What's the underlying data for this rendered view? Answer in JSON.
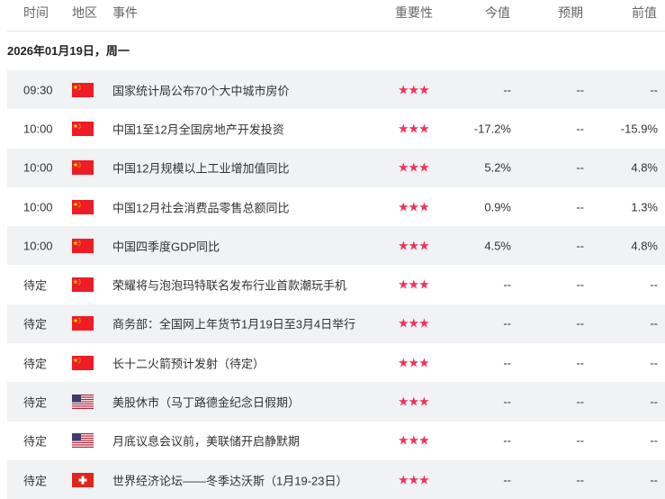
{
  "header": {
    "time": "时间",
    "region": "地区",
    "event": "事件",
    "importance": "重要性",
    "actual": "今值",
    "forecast": "预期",
    "previous": "前值"
  },
  "date": "2026年01月19日，周一",
  "rows": [
    {
      "time": "09:30",
      "flag": "cn",
      "event": "国家统计局公布70个大中城市房价",
      "stars": "★★★",
      "actual": "--",
      "forecast": "--",
      "previous": "--"
    },
    {
      "time": "10:00",
      "flag": "cn",
      "event": "中国1至12月全国房地产开发投资",
      "stars": "★★★",
      "actual": "-17.2%",
      "forecast": "--",
      "previous": "-15.9%"
    },
    {
      "time": "10:00",
      "flag": "cn",
      "event": "中国12月规模以上工业增加值同比",
      "stars": "★★★",
      "actual": "5.2%",
      "forecast": "--",
      "previous": "4.8%"
    },
    {
      "time": "10:00",
      "flag": "cn",
      "event": "中国12月社会消费品零售总额同比",
      "stars": "★★★",
      "actual": "0.9%",
      "forecast": "--",
      "previous": "1.3%"
    },
    {
      "time": "10:00",
      "flag": "cn",
      "event": "中国四季度GDP同比",
      "stars": "★★★",
      "actual": "4.5%",
      "forecast": "--",
      "previous": "4.8%"
    },
    {
      "time": "待定",
      "flag": "cn",
      "event": "荣耀将与泡泡玛特联名发布行业首款潮玩手机",
      "stars": "★★★",
      "actual": "--",
      "forecast": "--",
      "previous": "--"
    },
    {
      "time": "待定",
      "flag": "cn",
      "event": "商务部：全国网上年货节1月19日至3月4日举行",
      "stars": "★★★",
      "actual": "--",
      "forecast": "--",
      "previous": "--"
    },
    {
      "time": "待定",
      "flag": "cn",
      "event": "长十二火箭预计发射（待定）",
      "stars": "★★★",
      "actual": "--",
      "forecast": "--",
      "previous": "--"
    },
    {
      "time": "待定",
      "flag": "us",
      "event": "美股休市（马丁路德金纪念日假期）",
      "stars": "★★★",
      "actual": "--",
      "forecast": "--",
      "previous": "--"
    },
    {
      "time": "待定",
      "flag": "us",
      "event": "月底议息会议前，美联储开启静默期",
      "stars": "★★★",
      "actual": "--",
      "forecast": "--",
      "previous": "--"
    },
    {
      "time": "待定",
      "flag": "ch",
      "event": "世界经济论坛——冬季达沃斯（1月19-23日）",
      "stars": "★★★",
      "actual": "--",
      "forecast": "--",
      "previous": "--"
    }
  ]
}
